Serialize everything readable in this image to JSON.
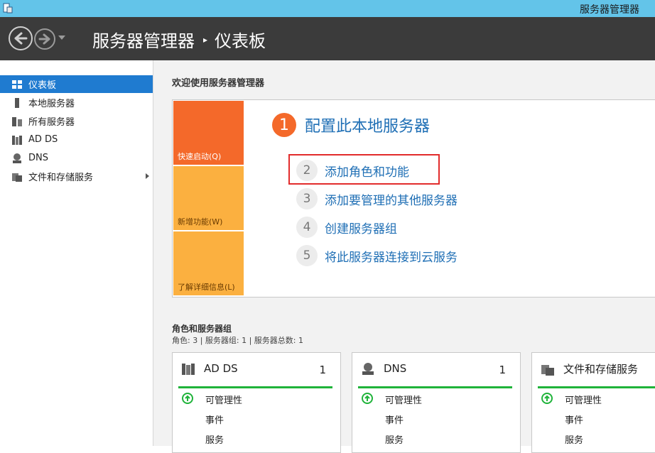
{
  "window": {
    "title": "服务器管理器"
  },
  "header": {
    "breadcrumb_root": "服务器管理器",
    "breadcrumb_sep": "▸",
    "breadcrumb_current": "仪表板"
  },
  "sidebar": {
    "items": [
      {
        "label": "仪表板",
        "icon": "dashboard-icon"
      },
      {
        "label": "本地服务器",
        "icon": "server-icon"
      },
      {
        "label": "所有服务器",
        "icon": "servers-icon"
      },
      {
        "label": "AD DS",
        "icon": "ad-ds-icon"
      },
      {
        "label": "DNS",
        "icon": "dns-icon"
      },
      {
        "label": "文件和存储服务",
        "icon": "file-storage-icon"
      }
    ]
  },
  "welcome": {
    "heading": "欢迎使用服务器管理器",
    "tiles": [
      "快速启动(Q)",
      "新增功能(W)",
      "了解详细信息(L)"
    ],
    "main_step": {
      "number": "1",
      "label": "配置此本地服务器"
    },
    "steps": [
      {
        "number": "2",
        "label": "添加角色和功能"
      },
      {
        "number": "3",
        "label": "添加要管理的其他服务器"
      },
      {
        "number": "4",
        "label": "创建服务器组"
      },
      {
        "number": "5",
        "label": "将此服务器连接到云服务"
      }
    ]
  },
  "roles": {
    "heading": "角色和服务器组",
    "summary": "角色: 3 | 服务器组: 1 | 服务器总数: 1",
    "cards": [
      {
        "title": "AD DS",
        "count": "1",
        "icon": "ad-ds-icon",
        "rows": [
          "可管理性",
          "事件",
          "服务"
        ]
      },
      {
        "title": "DNS",
        "count": "1",
        "icon": "dns-icon",
        "rows": [
          "可管理性",
          "事件",
          "服务"
        ]
      },
      {
        "title": "文件和存储服务",
        "count": "",
        "icon": "file-storage-icon",
        "rows": [
          "可管理性",
          "事件",
          "服务"
        ]
      }
    ]
  },
  "colors": {
    "titlebar": "#63c4e9",
    "header": "#3b3b3b",
    "accent": "#1f7bd0",
    "orange": "#f4692a",
    "amber": "#fbb040",
    "link": "#1f6fb5",
    "highlight": "#e22c2c",
    "ok": "#1fb33a"
  }
}
